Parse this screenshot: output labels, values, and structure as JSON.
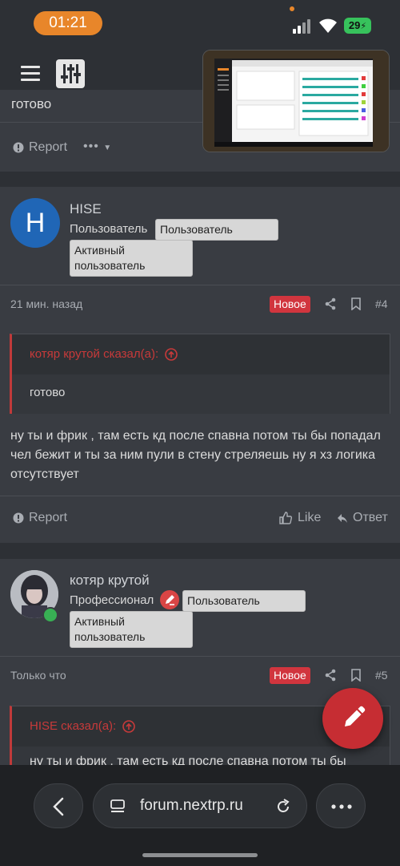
{
  "status_bar": {
    "time": "01:21",
    "battery": "29"
  },
  "prev_post": {
    "text": "готово",
    "report_label": "Report"
  },
  "post4": {
    "avatar_letter": "H",
    "username": "HISE",
    "role": "Пользователь",
    "tags": [
      "Пользователь",
      "Активный пользователь"
    ],
    "time": "21 мин. назад",
    "new_label": "Новое",
    "number": "#4",
    "quote_author": "котяр крутой сказал(а):",
    "quote_text": "готово",
    "message": "ну ты и фрик , там есть кд после спавна потом ты бы попадал чел бежит и ты за ним пули в стену стреляешь ну я хз логика отсутствует",
    "report_label": "Report",
    "like_label": "Like",
    "reply_label": "Ответ"
  },
  "post5": {
    "username": "котяр крутой",
    "role": "Профессионал",
    "tags": [
      "Пользователь",
      "Активный пользователь"
    ],
    "time": "Только что",
    "new_label": "Новое",
    "number": "#5",
    "quote_author": "HISE сказал(а):",
    "quote_preview": "ну ты и фрик , там есть кд после спавна потом ты бы"
  },
  "browser": {
    "url": "forum.nextrp.ru"
  },
  "colors": {
    "accent": "#d1353e",
    "status_time": "#e8862a",
    "battery": "#37c25c",
    "avatar_blue": "#2066b6"
  }
}
